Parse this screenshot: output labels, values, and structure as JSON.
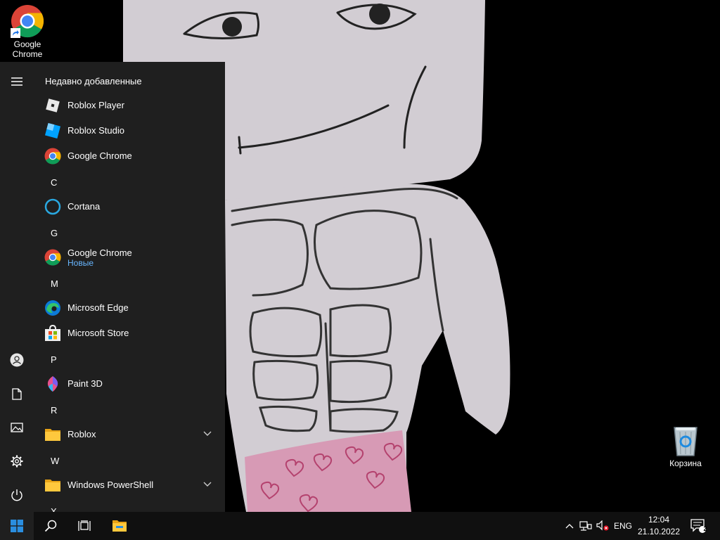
{
  "desktop": {
    "icons": [
      {
        "label_line1": "Google",
        "label_line2": "Chrome",
        "icon": "chrome-icon"
      },
      {
        "label": "Корзина",
        "icon": "recycle-bin-icon"
      }
    ]
  },
  "start_menu": {
    "header": "Недавно добавленные",
    "rail": [
      "hamburger-menu-icon",
      "user-account-icon",
      "documents-icon",
      "pictures-icon",
      "settings-gear-icon",
      "power-icon"
    ],
    "apps": {
      "roblox_player": "Roblox Player",
      "roblox_studio": "Roblox Studio",
      "chrome_recent": "Google Chrome",
      "letter_c": "C",
      "cortana": "Cortana",
      "letter_g": "G",
      "chrome": "Google Chrome",
      "chrome_badge": "Новые",
      "letter_m": "M",
      "edge": "Microsoft Edge",
      "store": "Microsoft Store",
      "letter_p": "P",
      "paint3d": "Paint 3D",
      "letter_r": "R",
      "roblox_folder": "Roblox",
      "letter_w": "W",
      "powershell_folder": "Windows PowerShell",
      "letter_x": "X"
    }
  },
  "taskbar": {
    "buttons": [
      "windows-start-icon",
      "search-icon",
      "task-view-icon",
      "file-explorer-icon"
    ],
    "tray": {
      "language": "ENG",
      "time": "12:04",
      "date": "21.10.2022",
      "notification_count": "2"
    }
  },
  "colors": {
    "start_bg": "#1f1f1f",
    "taskbar_bg": "#101010",
    "accent_blue": "#0078d7",
    "new_badge": "#68b6ff"
  }
}
